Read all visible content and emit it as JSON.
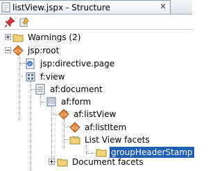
{
  "window": {
    "tab_title": "listView.jspx - Structure",
    "close_label": "✕"
  },
  "toolbar": {
    "pin_icon": "pin-icon",
    "edit_icon": "edit-properties-icon"
  },
  "tree": {
    "nodes": [
      {
        "label": "Warnings (2)",
        "icon": "folder-icon"
      },
      {
        "label": "jsp:root",
        "icon": "jsp-root-icon"
      },
      {
        "label": "jsp:directive.page",
        "icon": "directive-page-icon"
      },
      {
        "label": "f:view",
        "icon": "view-icon"
      },
      {
        "label": "af:document",
        "icon": "document-icon"
      },
      {
        "label": "af:form",
        "icon": "form-icon"
      },
      {
        "label": "af:listView",
        "icon": "list-view-icon"
      },
      {
        "label": "af:listItem",
        "icon": "list-item-icon"
      },
      {
        "label": "List View facets",
        "icon": "folder-icon"
      },
      {
        "label": "groupHeaderStamp",
        "icon": "folder-icon",
        "selected": true
      },
      {
        "label": "Document facets",
        "icon": "folder-icon"
      }
    ]
  },
  "colors": {
    "selection": "#1e5db4",
    "folder": "#f0d27a",
    "component": "#e8843a"
  }
}
